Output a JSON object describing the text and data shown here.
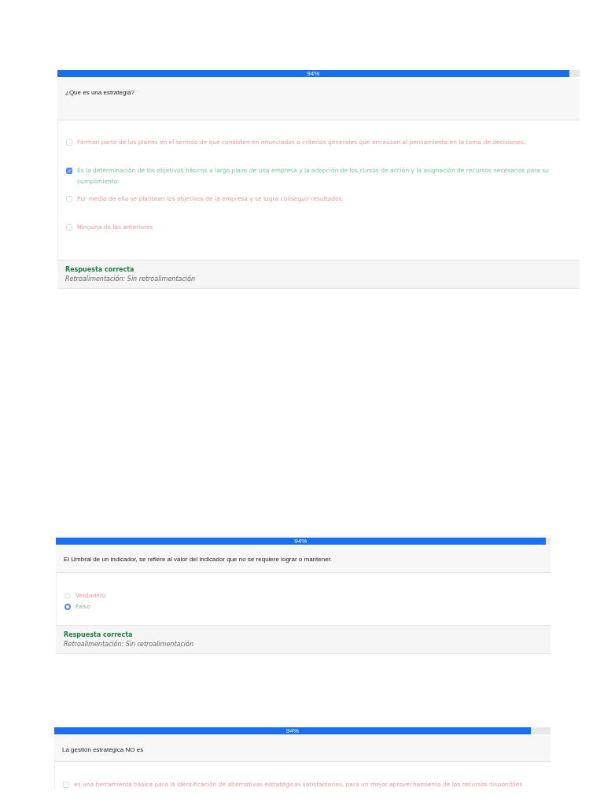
{
  "questions": [
    {
      "progress": {
        "label": "94%",
        "level": 0.98
      },
      "question": "¿Que es una estrategia?",
      "options": [
        {
          "kind": "checkbox",
          "text": "Forman parte de los planes en el sentido de que consisten en enunciados o criterios generales que encauzan al pensamiento en la toma de decisiones.",
          "checked": false,
          "correct": false
        },
        {
          "kind": "checkbox",
          "text": "Es la determinación de los objetivos básicos a largo plazo de una empresa y la adopción de los cursos de acción y la asignación de recursos necesarios para su cumplimiento.",
          "checked": true,
          "correct": true
        },
        {
          "kind": "checkbox",
          "text": "Por medio de ella se plantean los objetivos de la empresa y se logra conseguir resultados.",
          "checked": false,
          "correct": false
        },
        {
          "kind": "checkbox",
          "text": "Ninguna de las anteriores",
          "checked": false,
          "correct": false
        }
      ],
      "feedback": {
        "result": "Respuesta correcta",
        "comment": "Retroalimentación: Sin retroalimentación"
      }
    },
    {
      "progress": {
        "label": "94%",
        "level": 0.99
      },
      "question": "El Umbral de un indicador, se refiere al valor del indicador que no se requiere lograr o mantener.",
      "options": [
        {
          "kind": "radio",
          "text": "Verdadero",
          "checked": false,
          "correct": false
        },
        {
          "kind": "radio",
          "text": "Falso",
          "checked": true,
          "correct": true
        }
      ],
      "feedback": {
        "result": "Respuesta correcta",
        "comment": "Retroalimentación: Sin retroalimentación"
      }
    },
    {
      "progress": {
        "label": "94%",
        "level": 0.96
      },
      "question": "La gestión estratégica NO es",
      "options": [
        {
          "kind": "checkbox",
          "text": "es una herramienta básica para la identificación de alternativas estratégicas satisfactorias, para un mejor aprovechamiento de los recursos disponibles",
          "checked": false,
          "correct": false
        }
      ]
    }
  ]
}
